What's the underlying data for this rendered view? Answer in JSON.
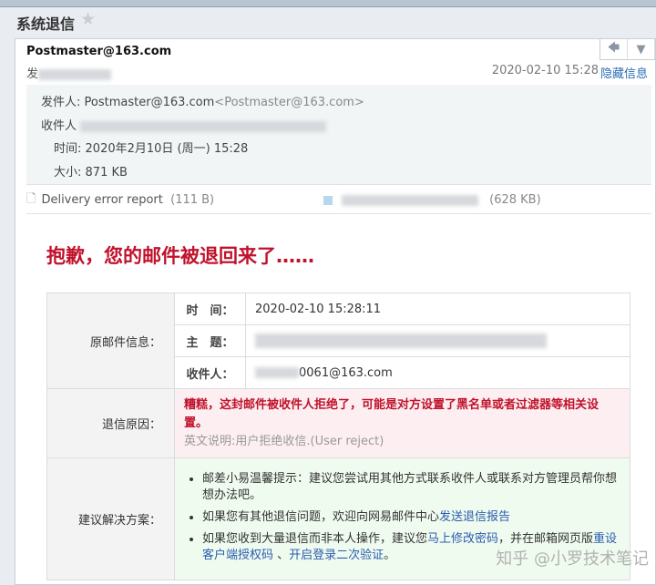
{
  "title": "系统退信",
  "sender": "Postmaster@163.com",
  "from_prefix": "发",
  "date": "2020-02-10 15:28",
  "hide_info": "隐藏信息",
  "details": {
    "from_label": "发件人:",
    "from_name": "Postmaster@163.com",
    "from_addr": "<Postmaster@163.com>",
    "to_label": "收件人",
    "time_label": "时间:",
    "time": "2020年2月10日 (周一) 15:28",
    "size_label": "大小:",
    "size": "871 KB"
  },
  "attachments": [
    {
      "name": "Delivery error report",
      "size": "(111 B)"
    },
    {
      "size": "(628 KB)"
    }
  ],
  "heading": "抱歉，您的邮件被退回来了……",
  "table": {
    "orig_label": "原邮件信息：",
    "time_label": "时　间：",
    "time": "2020-02-10 15:28:11",
    "subject_label": "主　题：",
    "to_label": "收件人：",
    "to_suffix": "0061@163.com",
    "reason_label": "退信原因：",
    "reason": "糟糕，这封邮件被收件人拒绝了，可能是对方设置了黑名单或者过滤器等相关设置。",
    "reason_en": "英文说明:用户拒绝收信.(User reject)",
    "solution_label": "建议解决方案：",
    "tip1": "邮差小易温馨提示：建议您尝试用其他方式联系收件人或联系对方管理员帮你想想办法吧。",
    "tip2": "如果您有其他退信问题，欢迎向网易邮件中心",
    "tip2_link": "发送退信报告",
    "tip3_a": "如果您收到大量退信而非本人操作，建议您",
    "tip3_link1": "马上修改密码",
    "tip3_b": "，并在邮箱网页版",
    "tip3_link2": "重设客户端授权码",
    "tip3_c": " 、",
    "tip3_link3": "开启登录二次验证",
    "tip3_d": "。"
  },
  "watermark": "知乎 @小罗技术笔记"
}
